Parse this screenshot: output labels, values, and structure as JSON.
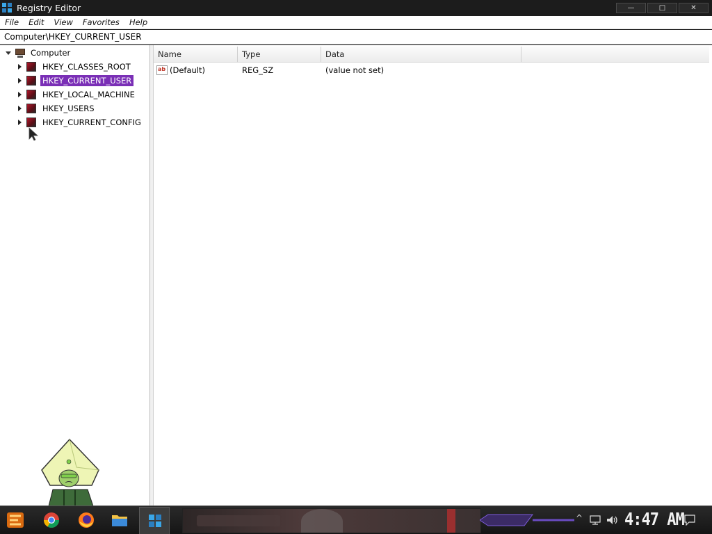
{
  "window": {
    "title": "Registry Editor",
    "controls": {
      "minimize": "—",
      "maximize": "□",
      "close": "✕"
    }
  },
  "menu": {
    "items": [
      "File",
      "Edit",
      "View",
      "Favorites",
      "Help"
    ]
  },
  "address": {
    "path": "Computer\\HKEY_CURRENT_USER"
  },
  "tree": {
    "root": {
      "label": "Computer",
      "expanded": true,
      "icon": "computer-icon"
    },
    "children": [
      {
        "label": "HKEY_CLASSES_ROOT",
        "selected": false,
        "icon": "hive-icon"
      },
      {
        "label": "HKEY_CURRENT_USER",
        "selected": true,
        "icon": "hive-icon"
      },
      {
        "label": "HKEY_LOCAL_MACHINE",
        "selected": false,
        "icon": "hive-icon"
      },
      {
        "label": "HKEY_USERS",
        "selected": false,
        "icon": "hive-icon"
      },
      {
        "label": "HKEY_CURRENT_CONFIG",
        "selected": false,
        "icon": "hive-icon"
      }
    ]
  },
  "list": {
    "columns": [
      "Name",
      "Type",
      "Data"
    ],
    "rows": [
      {
        "name": "(Default)",
        "type": "REG_SZ",
        "data": "(value not set)",
        "icon": "string-value-icon"
      }
    ]
  },
  "taskbar": {
    "icons": [
      "start-icon",
      "chrome-icon",
      "firefox-icon",
      "file-explorer-icon",
      "registry-editor-icon"
    ],
    "tray": {
      "chevron": "^"
    },
    "clock": "4:47 AM"
  },
  "colors": {
    "selection": "#7a2fb6",
    "titlebar": "#1c1c1c",
    "taskbar": "#1b1b1b"
  }
}
